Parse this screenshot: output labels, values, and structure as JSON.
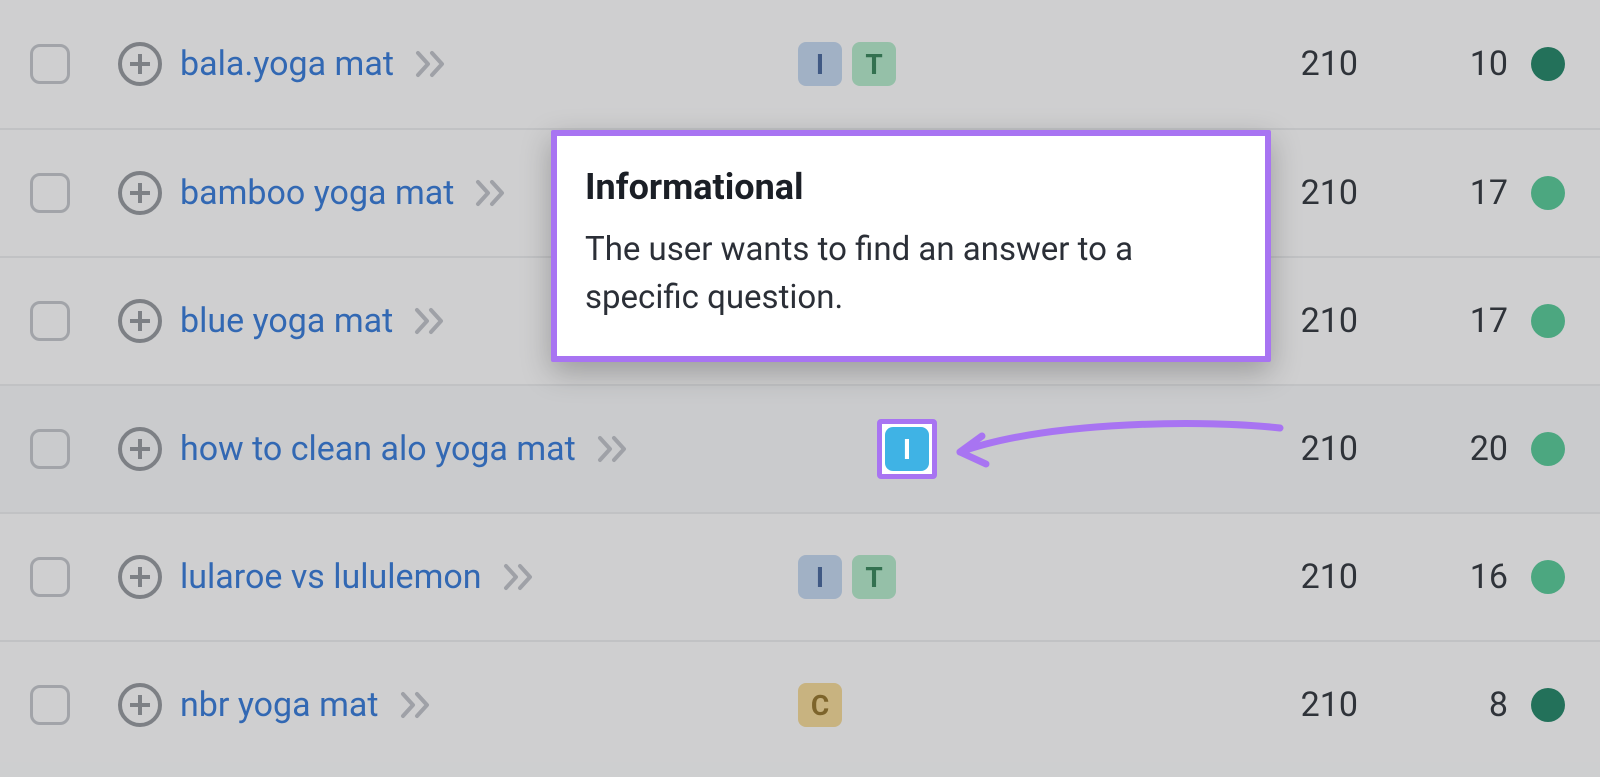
{
  "intent_labels": {
    "I": "I",
    "T": "T",
    "C": "C"
  },
  "tooltip": {
    "title": "Informational",
    "body": "The user wants to find an answer to a specific question."
  },
  "rows": [
    {
      "keyword": "bala.yoga mat",
      "intents": [
        "I",
        "T"
      ],
      "col_a": "210",
      "col_b": "10",
      "dot": "dark",
      "highlight": false
    },
    {
      "keyword": "bamboo yoga mat",
      "intents": [],
      "col_a": "210",
      "col_b": "17",
      "dot": "mid",
      "highlight": false
    },
    {
      "keyword": "blue yoga mat",
      "intents": [],
      "col_a": "210",
      "col_b": "17",
      "dot": "mid",
      "highlight": false
    },
    {
      "keyword": "how to clean alo yoga mat",
      "intents": [
        "I"
      ],
      "col_a": "210",
      "col_b": "20",
      "dot": "mid",
      "highlight": true
    },
    {
      "keyword": "lularoe vs lululemon",
      "intents": [
        "I",
        "T"
      ],
      "col_a": "210",
      "col_b": "16",
      "dot": "mid",
      "highlight": false
    },
    {
      "keyword": "nbr yoga mat",
      "intents": [
        "C"
      ],
      "col_a": "210",
      "col_b": "8",
      "dot": "dark",
      "highlight": false
    }
  ]
}
